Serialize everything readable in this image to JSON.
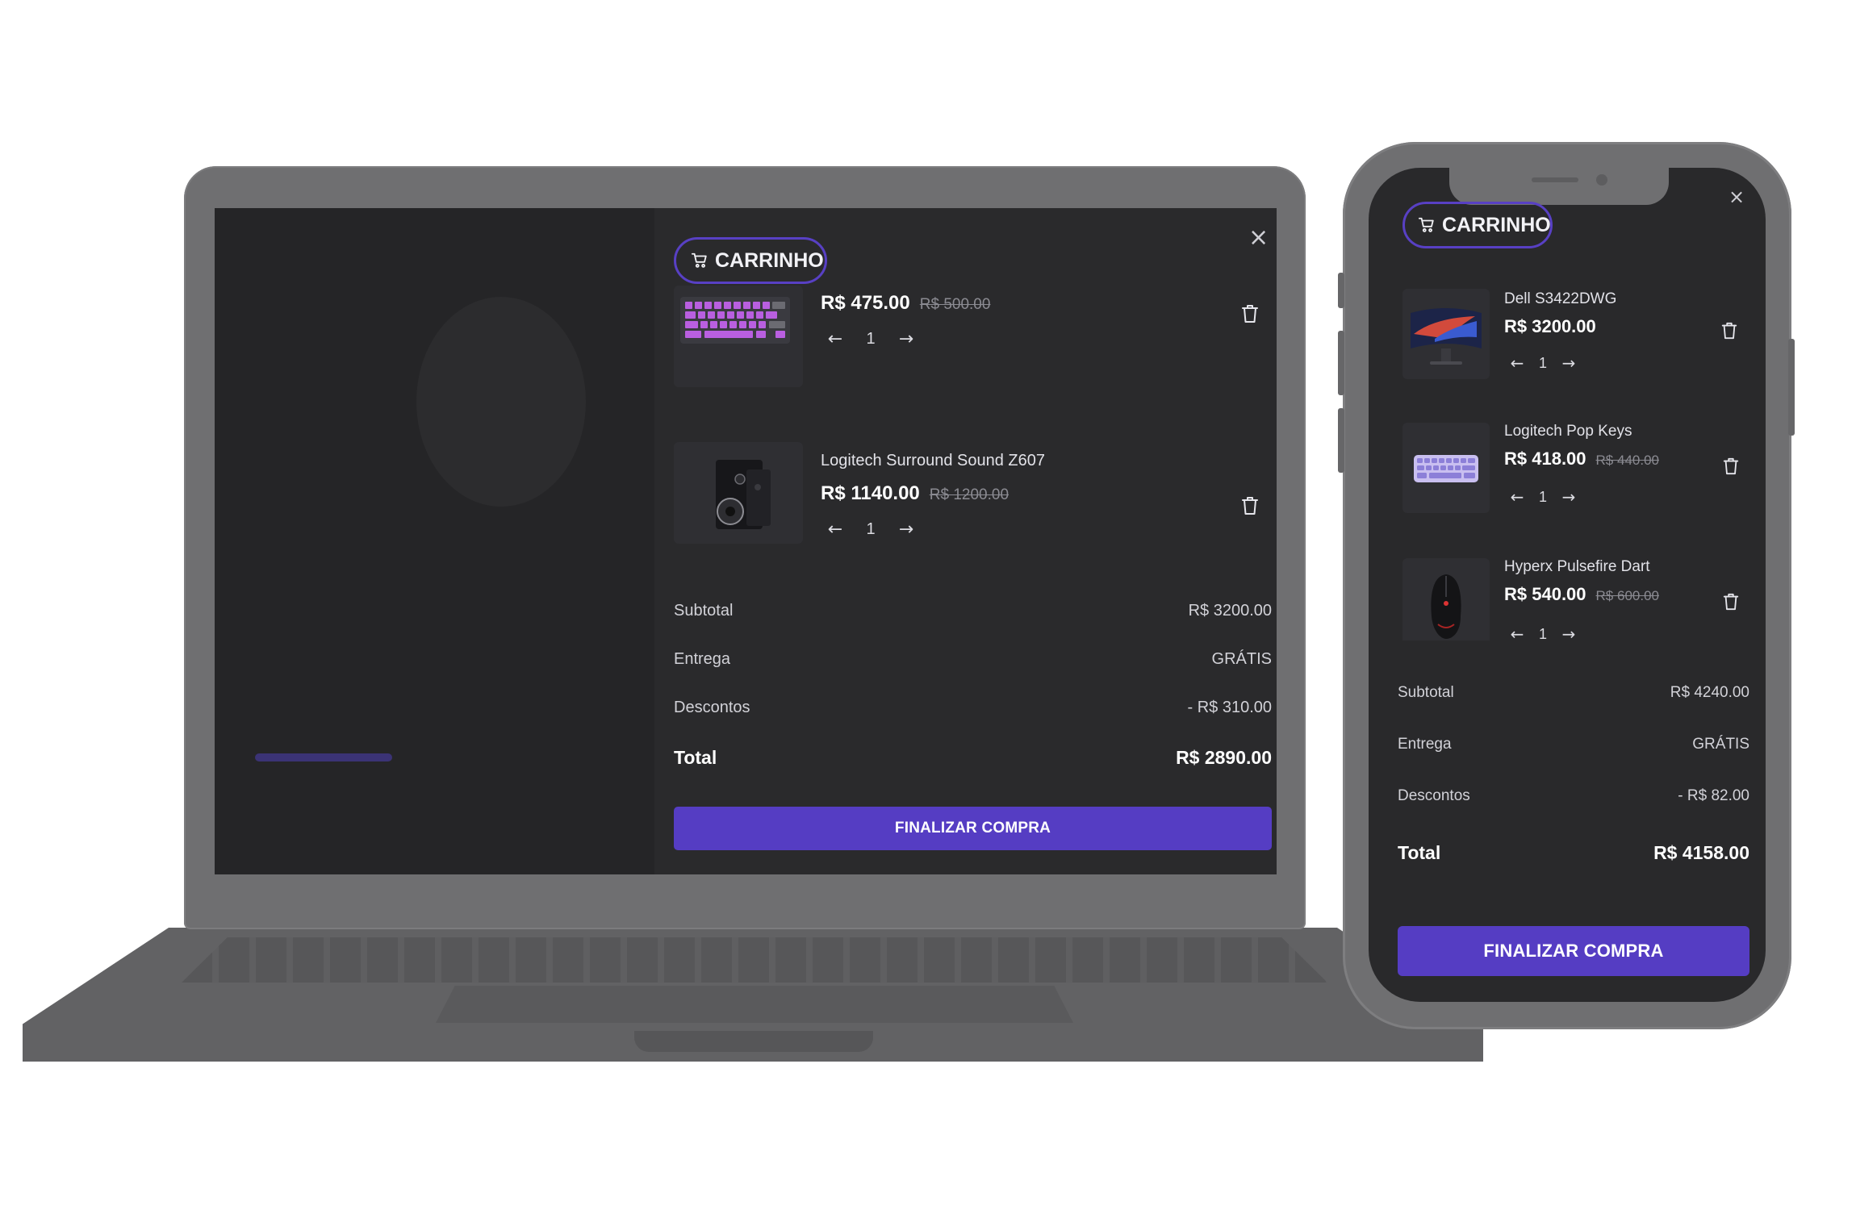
{
  "colors": {
    "accent": "#553dc3",
    "badge_border": "#5840c4",
    "panel_bg": "#2a2a2c",
    "device_frame": "#6f6f71"
  },
  "laptop": {
    "cart": {
      "badge": {
        "icon": "cart-icon",
        "label": "CARRINHO"
      },
      "close": "×",
      "items": [
        {
          "name": "",
          "thumb": "purple-keyboard",
          "price": "R$ 475.00",
          "old_price": "R$ 500.00",
          "qty": "1"
        },
        {
          "name": "Logitech Surround Sound Z607",
          "thumb": "speaker",
          "price": "R$ 1140.00",
          "old_price": "R$ 1200.00",
          "qty": "1"
        }
      ],
      "summary": {
        "subtotal_label": "Subtotal",
        "subtotal_value": "R$ 3200.00",
        "delivery_label": "Entrega",
        "delivery_value": "GRÁTIS",
        "discount_label": "Descontos",
        "discount_value": "- R$ 310.00",
        "total_label": "Total",
        "total_value": "R$ 2890.00"
      },
      "checkout": "FINALIZAR COMPRA"
    }
  },
  "phone": {
    "cart": {
      "badge": {
        "icon": "cart-icon",
        "label": "CARRINHO"
      },
      "close": "×",
      "items": [
        {
          "name": "Dell S3422DWG",
          "thumb": "monitor",
          "price": "R$ 3200.00",
          "old_price": "",
          "qty": "1"
        },
        {
          "name": "Logitech Pop Keys",
          "thumb": "lilac-keyboard",
          "price": "R$ 418.00",
          "old_price": "R$ 440.00",
          "qty": "1"
        },
        {
          "name": "Hyperx Pulsefire Dart",
          "thumb": "mouse",
          "price": "R$ 540.00",
          "old_price": "R$ 600.00",
          "qty": "1"
        }
      ],
      "summary": {
        "subtotal_label": "Subtotal",
        "subtotal_value": "R$ 4240.00",
        "delivery_label": "Entrega",
        "delivery_value": "GRÁTIS",
        "discount_label": "Descontos",
        "discount_value": "- R$ 82.00",
        "total_label": "Total",
        "total_value": "R$ 4158.00"
      },
      "checkout": "FINALIZAR COMPRA"
    }
  },
  "glyphs": {
    "prev": "←",
    "next": "→"
  }
}
